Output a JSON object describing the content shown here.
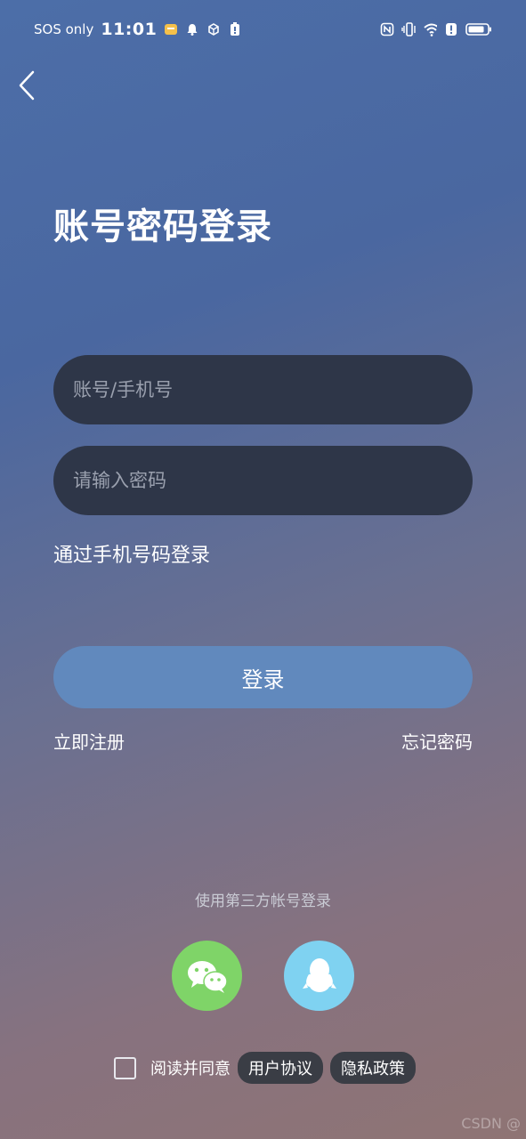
{
  "status_bar": {
    "carrier": "SOS only",
    "time": "11:01"
  },
  "header": {
    "title": "账号密码登录"
  },
  "form": {
    "account_placeholder": "账号/手机号",
    "password_placeholder": "请输入密码",
    "phone_login_link": "通过手机号码登录",
    "login_button": "登录",
    "register_link": "立即注册",
    "forgot_link": "忘记密码"
  },
  "third_party": {
    "label": "使用第三方帐号登录",
    "providers": [
      {
        "name": "wechat",
        "icon": "wechat-icon",
        "color": "#7fd468"
      },
      {
        "name": "qq",
        "icon": "qq-icon",
        "color": "#7fd2f1"
      }
    ]
  },
  "agreement": {
    "text": "阅读并同意",
    "user_agreement": "用户协议",
    "privacy_policy": "隐私政策",
    "checked": false
  },
  "watermark": "CSDN @"
}
